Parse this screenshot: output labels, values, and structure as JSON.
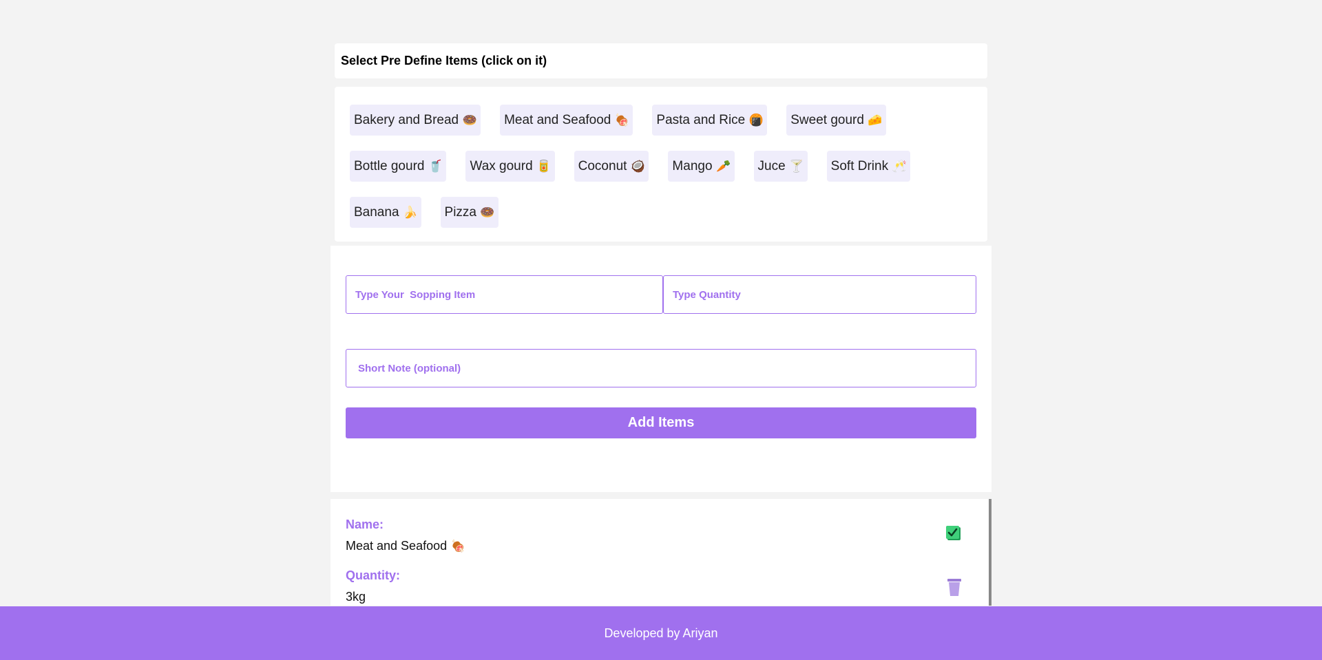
{
  "header": {
    "title": "Select Pre Define Items (click on it)"
  },
  "predefined_items": [
    [
      {
        "label": "Bakery and Bread",
        "emoji": "🍩"
      },
      {
        "label": "Meat and Seafood",
        "emoji": "🍖"
      },
      {
        "label": "Pasta and Rice",
        "emoji": "🍘"
      },
      {
        "label": "Sweet gourd",
        "emoji": "🧀"
      }
    ],
    [
      {
        "label": "Bottle gourd",
        "emoji": "🥤"
      },
      {
        "label": "Wax gourd",
        "emoji": "🥫"
      },
      {
        "label": "Coconut",
        "emoji": "🥥"
      },
      {
        "label": "Mango",
        "emoji": "🥕"
      },
      {
        "label": "Juce",
        "emoji": "🍸"
      },
      {
        "label": "Soft Drink",
        "emoji": "🥂"
      }
    ],
    [
      {
        "label": "Banana",
        "emoji": "🍌"
      },
      {
        "label": "Pizza",
        "emoji": "🍩"
      }
    ]
  ],
  "form": {
    "shopping_item_placeholder": "Type Your  Sopping Item",
    "quantity_placeholder": "Type Quantity",
    "note_placeholder": "Short Note (optional)",
    "add_button_label": "Add Items"
  },
  "list": {
    "items": [
      {
        "name_label": "Name:",
        "name": "Meat and Seafood",
        "name_emoji": "🍖",
        "quantity_label": "Quantity:",
        "quantity": "3kg"
      }
    ]
  },
  "footer": {
    "text": "Developed by Ariyan"
  },
  "colors": {
    "accent": "#a070ee",
    "background": "#f3f3f3",
    "chip": "#efedfb",
    "check_green": "#2ecc71"
  }
}
